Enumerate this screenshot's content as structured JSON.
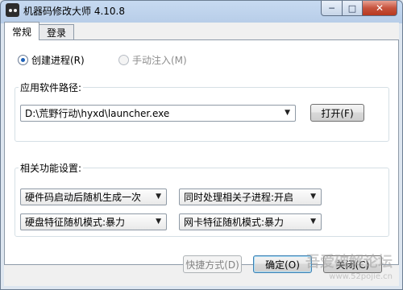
{
  "window": {
    "title": "机器码修改大师 4.10.8",
    "controls": {
      "minimize": "─",
      "maximize": "□",
      "close": "✕"
    }
  },
  "tabs": [
    {
      "label": "常规",
      "active": true
    },
    {
      "label": "登录",
      "active": false
    }
  ],
  "launch_mode": {
    "create_process": {
      "label": "创建进程(R)",
      "selected": true
    },
    "manual_inject": {
      "label": "手动注入(M)",
      "selected": false,
      "disabled": true
    }
  },
  "app_path": {
    "legend": "应用软件路径:",
    "value": "D:\\荒野行动\\hyxd\\launcher.exe",
    "open_button": "打开(F)"
  },
  "features": {
    "legend": "相关功能设置:",
    "options": [
      {
        "value": "硬件码启动后随机生成一次"
      },
      {
        "value": "同时处理相关子进程:开启"
      },
      {
        "value": "硬盘特征随机模式:暴力"
      },
      {
        "value": "网卡特征随机模式:暴力"
      }
    ]
  },
  "footer": {
    "shortcut_button": "快捷方式(D)",
    "ok_button": "确定(O)",
    "cancel_button": "关闭(C)"
  },
  "watermark": {
    "text": "吾爱破解论坛",
    "url": "www.52pojie.cn"
  },
  "colors": {
    "accent": "#1d61b8",
    "close": "#c6533d",
    "frame": "#b7cde8"
  }
}
